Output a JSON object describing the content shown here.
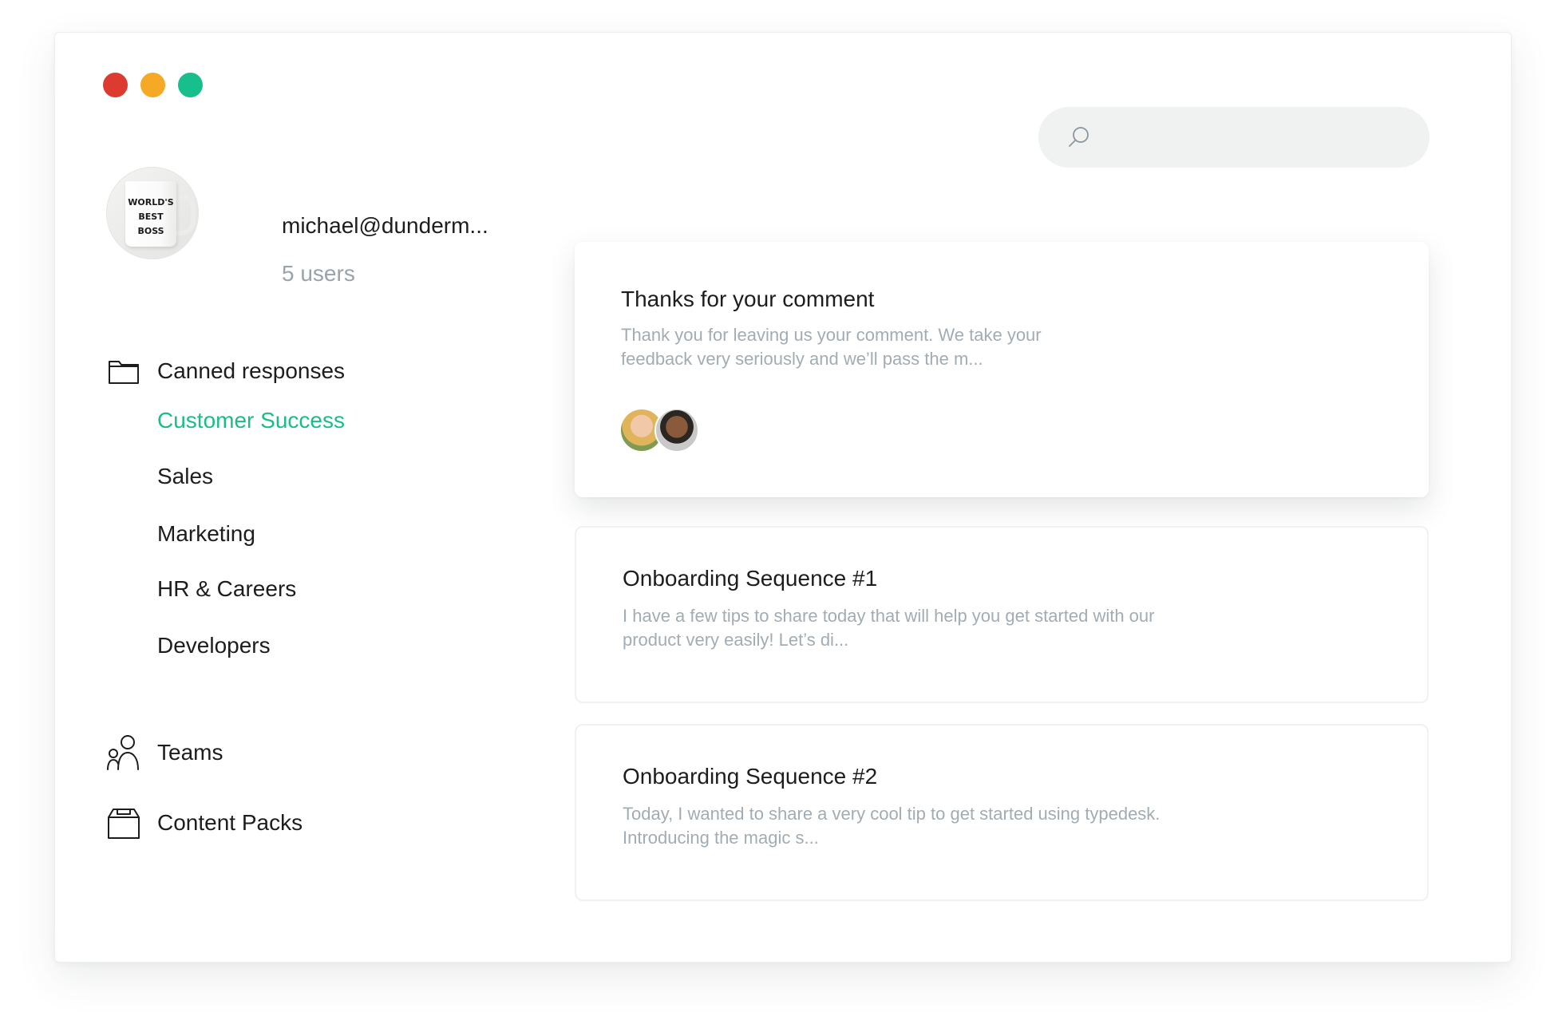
{
  "window": {
    "controls": [
      {
        "name": "close",
        "color": "#dd3b2f"
      },
      {
        "name": "minimize",
        "color": "#f5a924"
      },
      {
        "name": "zoom",
        "color": "#16bf8c"
      }
    ]
  },
  "search": {
    "icon": "search-icon",
    "placeholder": ""
  },
  "profile": {
    "avatar_text": [
      "WORLD'S",
      "BEST",
      "BOSS"
    ],
    "email": "michael@dunderm...",
    "users": "5 users"
  },
  "nav": {
    "canned_responses": {
      "icon": "folder-icon",
      "label": "Canned responses",
      "items": [
        {
          "label": "Customer Success",
          "active": true
        },
        {
          "label": "Sales",
          "active": false
        },
        {
          "label": "Marketing",
          "active": false
        },
        {
          "label": "HR & Careers",
          "active": false
        },
        {
          "label": "Developers",
          "active": false
        }
      ]
    },
    "teams": {
      "icon": "users-icon",
      "label": "Teams"
    },
    "content_packs": {
      "icon": "box-icon",
      "label": "Content Packs"
    }
  },
  "colors": {
    "accent": "#1ebb8a",
    "text_primary": "#1d1d1f",
    "text_muted": "#a2acb3"
  },
  "cards": [
    {
      "title": "Thanks for your comment",
      "body": "Thank you for leaving us your comment. We take your feedback very seriously and we’ll pass the m...",
      "avatars": [
        "user-avatar-1",
        "user-avatar-2"
      ],
      "selected": true
    },
    {
      "title": "Onboarding Sequence #1",
      "body": "I have a few tips to share today that will help you get started with our product very easily! Let’s di...",
      "selected": false
    },
    {
      "title": "Onboarding Sequence #2",
      "body": "Today, I wanted to share a very cool tip to get started using typedesk. Introducing the magic s...",
      "selected": false
    }
  ]
}
